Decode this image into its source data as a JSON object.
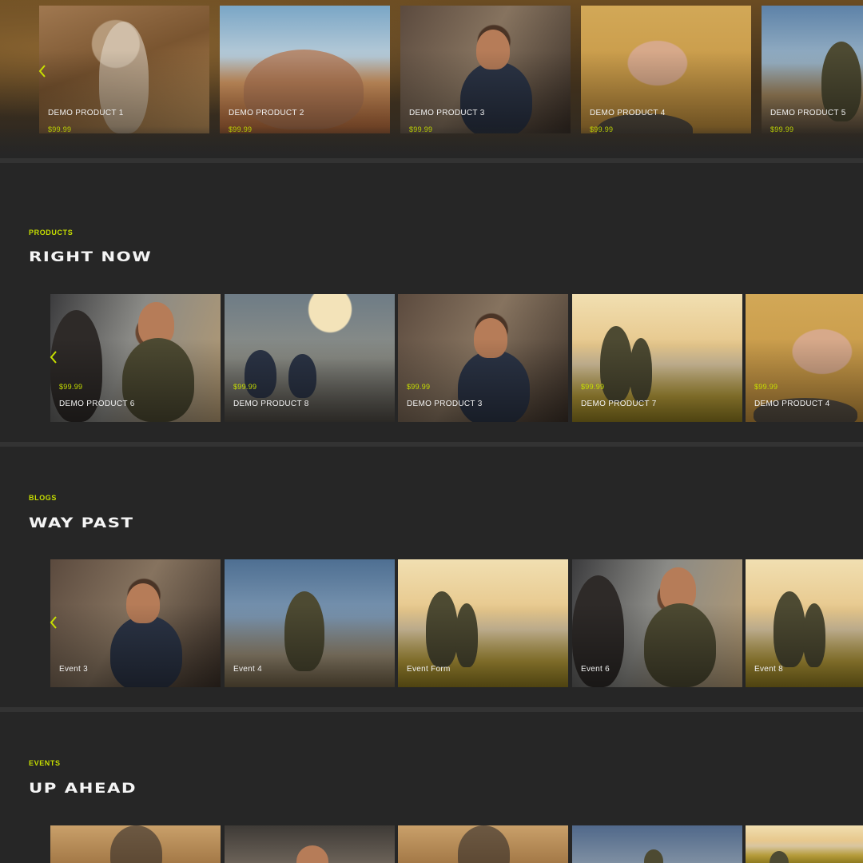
{
  "top_products": {
    "items": [
      {
        "title": "DEMO PRODUCT 1",
        "price": "$99.99",
        "image": "astronaut-desert"
      },
      {
        "title": "DEMO PRODUCT 2",
        "price": "$99.99",
        "image": "hands-reaching-sky"
      },
      {
        "title": "DEMO PRODUCT 3",
        "price": "$99.99",
        "image": "man-podcast-headphones"
      },
      {
        "title": "DEMO PRODUCT 4",
        "price": "$99.99",
        "image": "shaved-head-woman-portrait"
      },
      {
        "title": "DEMO PRODUCT 5",
        "price": "$99.99",
        "image": "man-sunglasses-beach"
      }
    ]
  },
  "products_section": {
    "eyebrow": "PRODUCTS",
    "heading": "RIGHT NOW",
    "items": [
      {
        "title": "DEMO PRODUCT 6",
        "price": "$99.99",
        "image": "man-dreadlocks-phone"
      },
      {
        "title": "DEMO PRODUCT 8",
        "price": "$99.99",
        "image": "office-lounge"
      },
      {
        "title": "DEMO PRODUCT 3",
        "price": "$99.99",
        "image": "man-podcast-headphones"
      },
      {
        "title": "DEMO PRODUCT 7",
        "price": "$99.99",
        "image": "father-child-lake"
      },
      {
        "title": "DEMO PRODUCT 4",
        "price": "$99.99",
        "image": "shaved-head-woman-portrait"
      }
    ]
  },
  "blogs_section": {
    "eyebrow": "BLOGS",
    "heading": "WAY PAST",
    "items": [
      {
        "title": "Event 3",
        "image": "man-podcast-headphones"
      },
      {
        "title": "Event 4",
        "image": "man-sunglasses-beach"
      },
      {
        "title": "Event Form",
        "image": "father-child-lake"
      },
      {
        "title": "Event 6",
        "image": "man-dreadlocks-phone"
      },
      {
        "title": "Event 8",
        "image": "father-child-lake"
      }
    ]
  },
  "events_section": {
    "eyebrow": "EVENTS",
    "heading": "UP AHEAD"
  },
  "icons": {
    "carousel_prev": "chevron-left-icon"
  },
  "colors": {
    "background": "#262626",
    "accent": "#c7df00",
    "text": "#f1f1f1",
    "divider": "#333333"
  }
}
